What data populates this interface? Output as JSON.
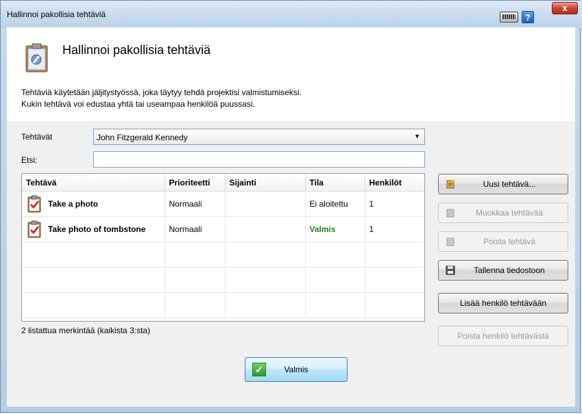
{
  "window": {
    "title": "Hallinnoi pakollisia tehtäviä",
    "help_label": "?",
    "close_label": "x"
  },
  "header": {
    "title": "Hallinnoi pakollisia tehtäviä",
    "description_line1": "Tehtäviä käytetään jäljitystyössä, joka täytyy tehdä projektisi valmistumiseksi.",
    "description_line2": "Kukin tehtävä voi edustaa yhtä tai useampaa henkilöä puussasi."
  },
  "filter": {
    "tasks_label": "Tehtävät",
    "selected_person": "John Fitzgerald Kennedy",
    "search_label": "Etsi:",
    "search_value": ""
  },
  "table": {
    "columns": [
      "Tehtävä",
      "Prioriteetti",
      "Sijainti",
      "Tila",
      "Henkilöt"
    ],
    "rows": [
      {
        "task": "Take a photo",
        "priority": "Normaali",
        "location": "",
        "status": "Ei aloitettu",
        "people": "1"
      },
      {
        "task": "Take photo of tombstone",
        "priority": "Normaali",
        "location": "",
        "status": "Valmis",
        "people": "1"
      }
    ],
    "summary": "2 listattua merkintää (kaikista 3:sta)"
  },
  "actions": {
    "new_task": "Uusi tehtävä...",
    "edit_task": "Muokkaa tehtävää",
    "delete_task": "Poista tehtävä",
    "save_to_file": "Tallenna tiedostoon",
    "add_person": "Lisää henkilö tehtävään",
    "remove_person": "Poista henkilö tehtävästä",
    "ok": "Valmis"
  },
  "colors": {
    "status_done": "#1a8a1a",
    "titlebar": "#c9dcef"
  }
}
